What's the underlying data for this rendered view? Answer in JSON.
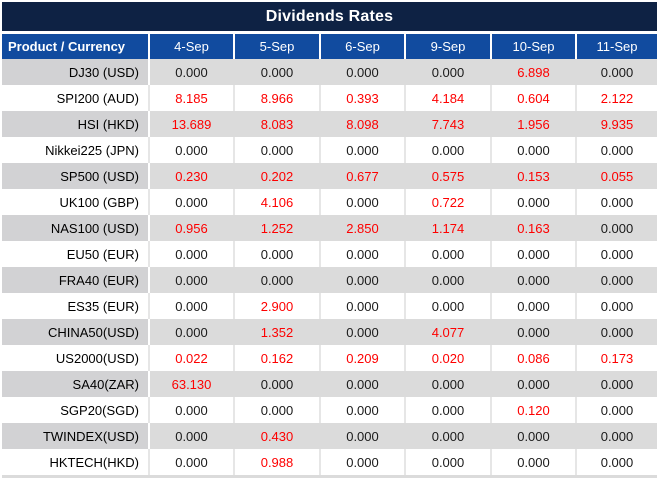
{
  "title": "Dividends Rates",
  "colors": {
    "title_bg": "#0E2244",
    "header_bg": "#114B9F",
    "header_text": "#FFFFFF",
    "stripe_label_gray": "#D2D2D4",
    "stripe_data_gray": "#DBDBDB",
    "value_red": "#FE0000",
    "value_black": "#1A1A1A"
  },
  "chart_data": {
    "type": "table",
    "title": "Dividends Rates",
    "label_header": "Product / Currency",
    "date_headers": [
      "4-Sep",
      "5-Sep",
      "6-Sep",
      "9-Sep",
      "10-Sep",
      "11-Sep"
    ],
    "rows": [
      {
        "label": "DJ30 (USD)",
        "values": [
          "0.000",
          "0.000",
          "0.000",
          "0.000",
          "6.898",
          "0.000"
        ],
        "red": [
          false,
          false,
          false,
          false,
          true,
          false
        ]
      },
      {
        "label": "SPI200 (AUD)",
        "values": [
          "8.185",
          "8.966",
          "0.393",
          "4.184",
          "0.604",
          "2.122"
        ],
        "red": [
          true,
          true,
          true,
          true,
          true,
          true
        ]
      },
      {
        "label": "HSI (HKD)",
        "values": [
          "13.689",
          "8.083",
          "8.098",
          "7.743",
          "1.956",
          "9.935"
        ],
        "red": [
          true,
          true,
          true,
          true,
          true,
          true
        ]
      },
      {
        "label": "Nikkei225 (JPN)",
        "values": [
          "0.000",
          "0.000",
          "0.000",
          "0.000",
          "0.000",
          "0.000"
        ],
        "red": [
          false,
          false,
          false,
          false,
          false,
          false
        ]
      },
      {
        "label": "SP500 (USD)",
        "values": [
          "0.230",
          "0.202",
          "0.677",
          "0.575",
          "0.153",
          "0.055"
        ],
        "red": [
          true,
          true,
          true,
          true,
          true,
          true
        ]
      },
      {
        "label": "UK100 (GBP)",
        "values": [
          "0.000",
          "4.106",
          "0.000",
          "0.722",
          "0.000",
          "0.000"
        ],
        "red": [
          false,
          true,
          false,
          true,
          false,
          false
        ]
      },
      {
        "label": "NAS100 (USD)",
        "values": [
          "0.956",
          "1.252",
          "2.850",
          "1.174",
          "0.163",
          "0.000"
        ],
        "red": [
          true,
          true,
          true,
          true,
          true,
          false
        ]
      },
      {
        "label": "EU50 (EUR)",
        "values": [
          "0.000",
          "0.000",
          "0.000",
          "0.000",
          "0.000",
          "0.000"
        ],
        "red": [
          false,
          false,
          false,
          false,
          false,
          false
        ]
      },
      {
        "label": "FRA40 (EUR)",
        "values": [
          "0.000",
          "0.000",
          "0.000",
          "0.000",
          "0.000",
          "0.000"
        ],
        "red": [
          false,
          false,
          false,
          false,
          false,
          false
        ]
      },
      {
        "label": "ES35 (EUR)",
        "values": [
          "0.000",
          "2.900",
          "0.000",
          "0.000",
          "0.000",
          "0.000"
        ],
        "red": [
          false,
          true,
          false,
          false,
          false,
          false
        ]
      },
      {
        "label": "CHINA50(USD)",
        "values": [
          "0.000",
          "1.352",
          "0.000",
          "4.077",
          "0.000",
          "0.000"
        ],
        "red": [
          false,
          true,
          false,
          true,
          false,
          false
        ]
      },
      {
        "label": "US2000(USD)",
        "values": [
          "0.022",
          "0.162",
          "0.209",
          "0.020",
          "0.086",
          "0.173"
        ],
        "red": [
          true,
          true,
          true,
          true,
          true,
          true
        ]
      },
      {
        "label": "SA40(ZAR)",
        "values": [
          "63.130",
          "0.000",
          "0.000",
          "0.000",
          "0.000",
          "0.000"
        ],
        "red": [
          true,
          false,
          false,
          false,
          false,
          false
        ]
      },
      {
        "label": "SGP20(SGD)",
        "values": [
          "0.000",
          "0.000",
          "0.000",
          "0.000",
          "0.120",
          "0.000"
        ],
        "red": [
          false,
          false,
          false,
          false,
          true,
          false
        ]
      },
      {
        "label": "TWINDEX(USD)",
        "values": [
          "0.000",
          "0.430",
          "0.000",
          "0.000",
          "0.000",
          "0.000"
        ],
        "red": [
          false,
          true,
          false,
          false,
          false,
          false
        ]
      },
      {
        "label": "HKTECH(HKD)",
        "values": [
          "0.000",
          "0.988",
          "0.000",
          "0.000",
          "0.000",
          "0.000"
        ],
        "red": [
          false,
          true,
          false,
          false,
          false,
          false
        ]
      }
    ]
  }
}
